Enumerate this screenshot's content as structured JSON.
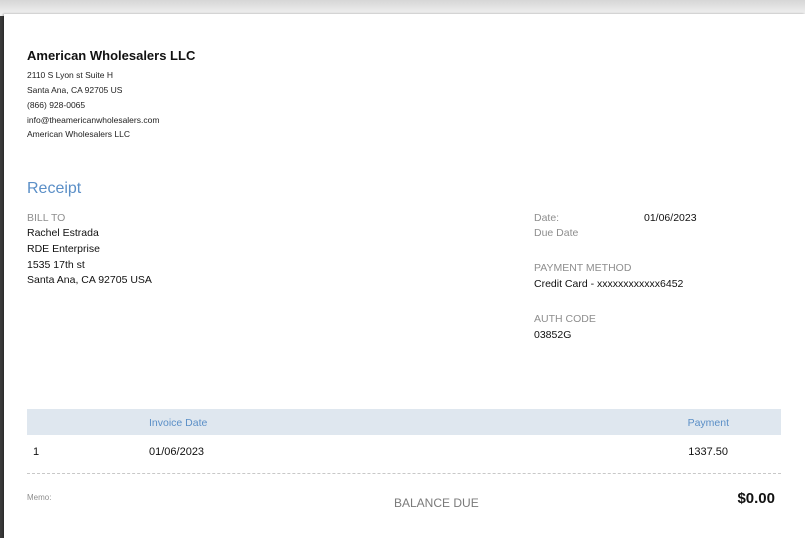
{
  "company": {
    "name": "American Wholesalers LLC",
    "address_line1": "2110 S Lyon st Suite H",
    "address_line2": "Santa Ana, CA  92705 US",
    "phone": "(866) 928-0065",
    "email": "info@theamericanwholesalers.com",
    "website_name": "American Wholesalers LLC"
  },
  "document": {
    "title": "Receipt"
  },
  "bill_to": {
    "label": "BILL TO",
    "name": "Rachel Estrada",
    "company": "RDE Enterprise",
    "street": "1535 17th st",
    "city": "Santa Ana, CA  92705 USA"
  },
  "details": {
    "date_label": "Date:",
    "date_value": "01/06/2023",
    "due_date_label": "Due Date",
    "payment_method_label": "PAYMENT METHOD",
    "payment_method_value": "Credit Card - xxxxxxxxxxxx6452",
    "auth_code_label": "AUTH CODE",
    "auth_code_value": "03852G"
  },
  "table": {
    "headers": {
      "invoice_date": "Invoice Date",
      "payment": "Payment"
    },
    "rows": [
      {
        "number": "1",
        "invoice_date": "01/06/2023",
        "payment": "1337.50"
      }
    ]
  },
  "footer": {
    "memo_label": "Memo:",
    "balance_label": "BALANCE DUE",
    "balance_value": "$0.00"
  }
}
